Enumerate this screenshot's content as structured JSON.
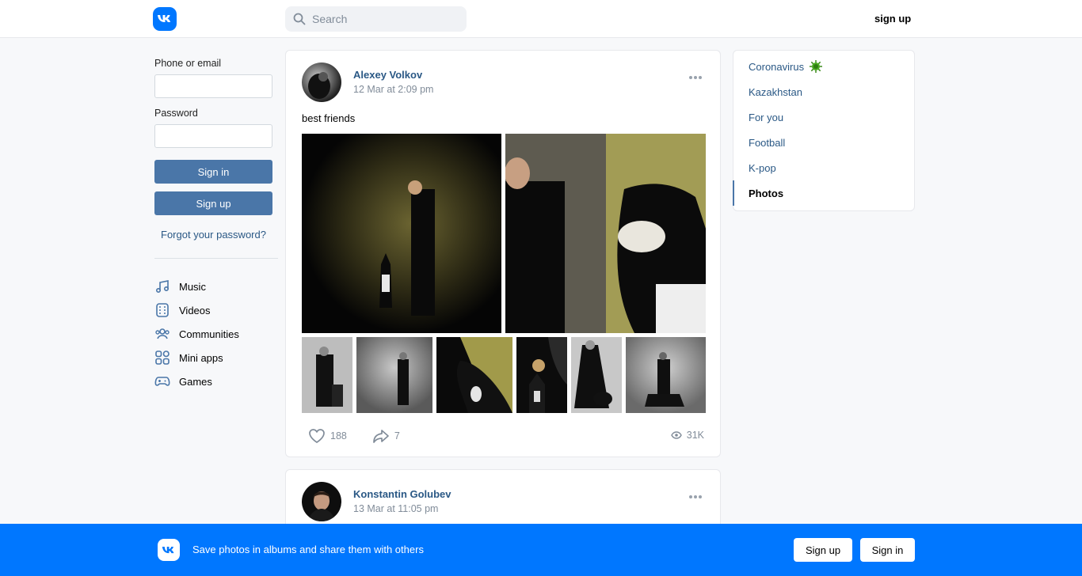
{
  "header": {
    "logo_text": "VK",
    "search_placeholder": "Search",
    "signup_label": "sign up"
  },
  "login": {
    "phone_label": "Phone or email",
    "password_label": "Password",
    "signin_label": "Sign in",
    "signup_label": "Sign up",
    "forgot_label": "Forgot your password?"
  },
  "nav": {
    "items": [
      {
        "label": "Music",
        "icon": "music-icon"
      },
      {
        "label": "Videos",
        "icon": "video-icon"
      },
      {
        "label": "Communities",
        "icon": "communities-icon"
      },
      {
        "label": "Mini apps",
        "icon": "mini-apps-icon"
      },
      {
        "label": "Games",
        "icon": "gamepad-icon"
      }
    ]
  },
  "posts": [
    {
      "author": "Alexey Volkov",
      "time": "12 Mar at 2:09 pm",
      "text": "best friends",
      "likes": "188",
      "shares": "7",
      "views": "31K"
    },
    {
      "author": "Konstantin Golubev",
      "time": "13 Mar at 11:05 pm"
    }
  ],
  "topics": {
    "items": [
      {
        "label": "Coronavirus"
      },
      {
        "label": "Kazakhstan"
      },
      {
        "label": "For you"
      },
      {
        "label": "Football"
      },
      {
        "label": "K-pop"
      },
      {
        "label": "Photos"
      }
    ],
    "active": "Photos"
  },
  "banner": {
    "text": "Save photos in albums and share them with others",
    "signup_label": "Sign up",
    "signin_label": "Sign in"
  },
  "colors": {
    "brand": "#0077ff",
    "button": "#4a76a8",
    "link": "#2a5885"
  }
}
